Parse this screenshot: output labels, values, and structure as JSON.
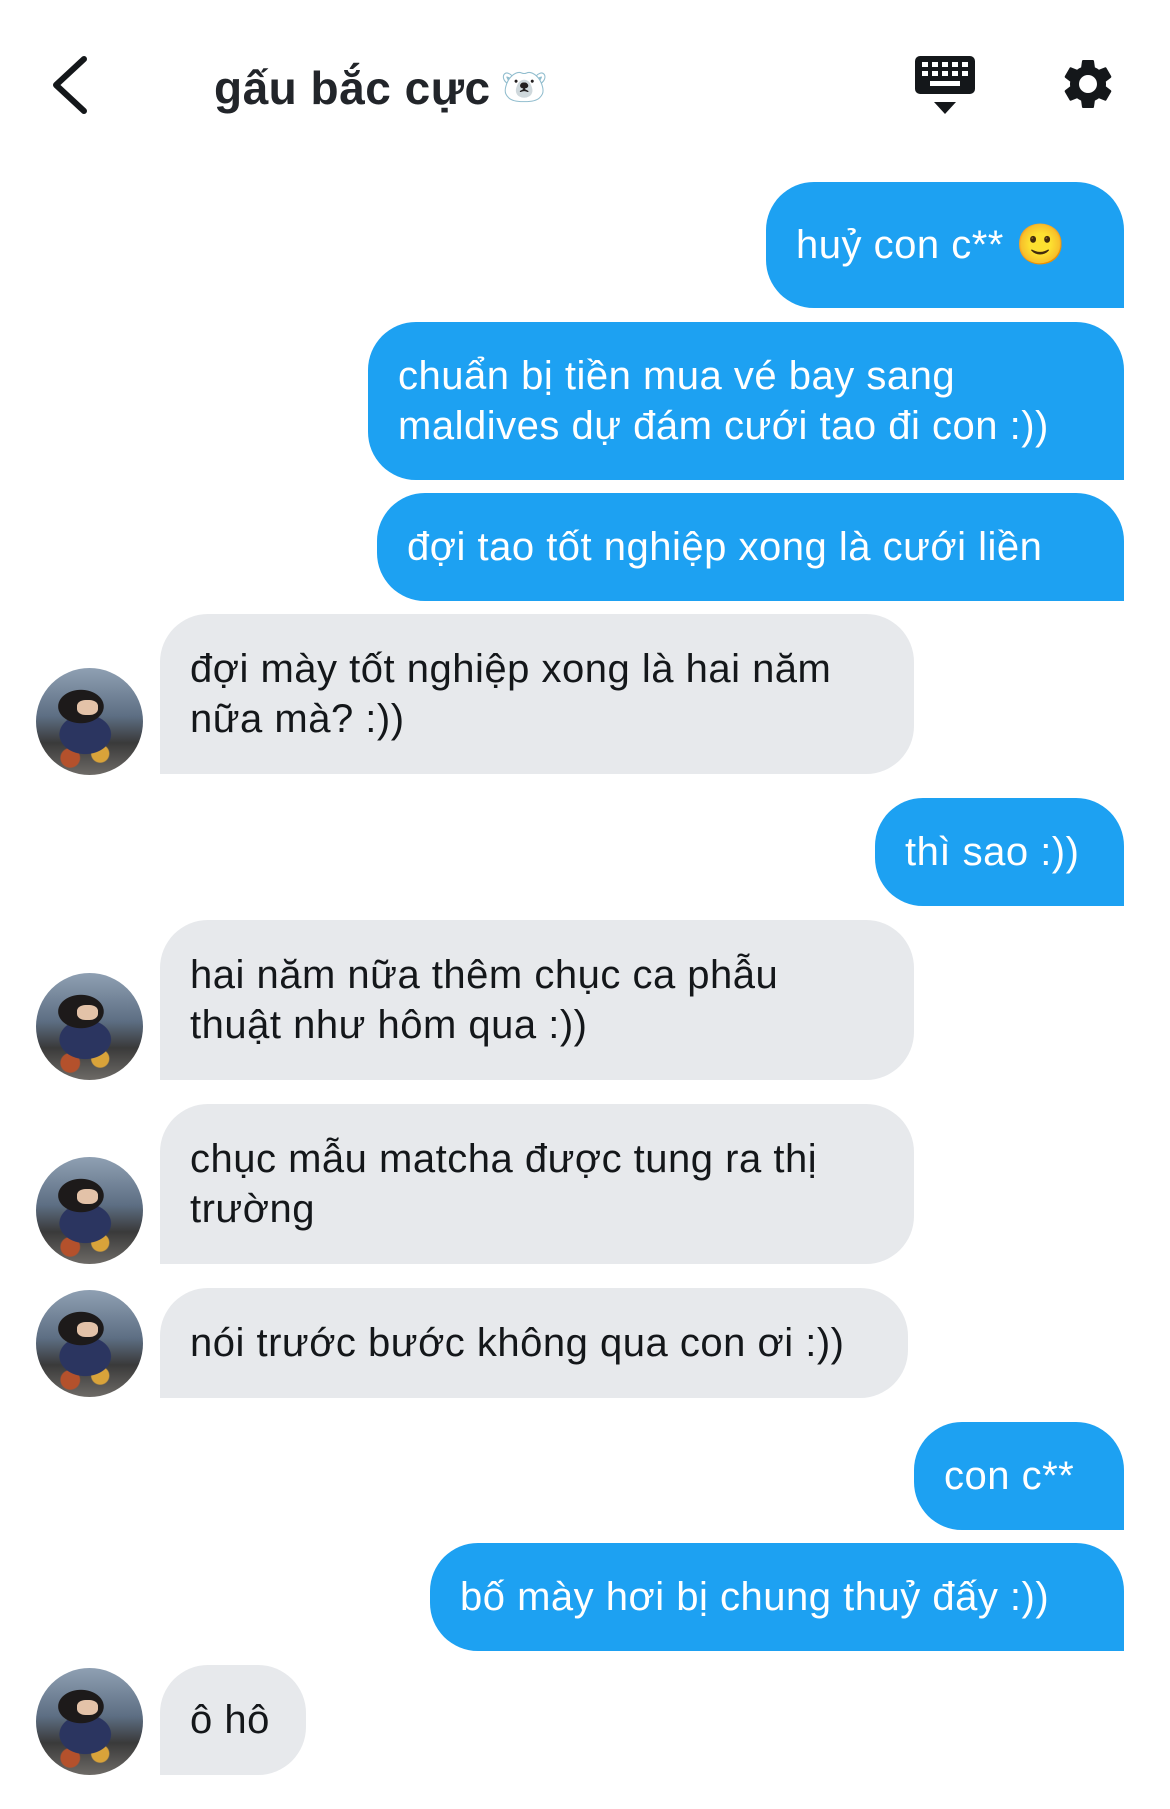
{
  "header": {
    "title": "gấu bắc cực",
    "title_emoji": "🐻‍❄️",
    "back_icon": "chevron-left-icon",
    "keyboard_icon": "keyboard-hide-icon",
    "settings_icon": "gear-icon"
  },
  "colors": {
    "sent": "#1da1f2",
    "received": "#e7e9ec"
  },
  "messages": [
    {
      "from": "me",
      "text": "huỷ con c** 🙂"
    },
    {
      "from": "me",
      "text": "chuẩn bị tiền mua vé bay sang\nmaldives dự đám cưới tao đi con :))"
    },
    {
      "from": "me",
      "text": "đợi tao tốt nghiệp xong là cưới liền"
    },
    {
      "from": "them",
      "text": "đợi mày tốt nghiệp xong là hai năm\nnữa mà? :))"
    },
    {
      "from": "me",
      "text": "thì sao :))"
    },
    {
      "from": "them",
      "text": "hai năm nữa thêm chục ca phẫu\nthuật như hôm qua :))"
    },
    {
      "from": "them",
      "text": "chục mẫu matcha được tung ra thị\ntrường"
    },
    {
      "from": "them",
      "text": "nói trước bước không qua con ơi :))"
    },
    {
      "from": "me",
      "text": "con c**"
    },
    {
      "from": "me",
      "text": "bố mày hơi bị chung thuỷ đấy :))"
    },
    {
      "from": "them",
      "text": "ô hô"
    }
  ]
}
